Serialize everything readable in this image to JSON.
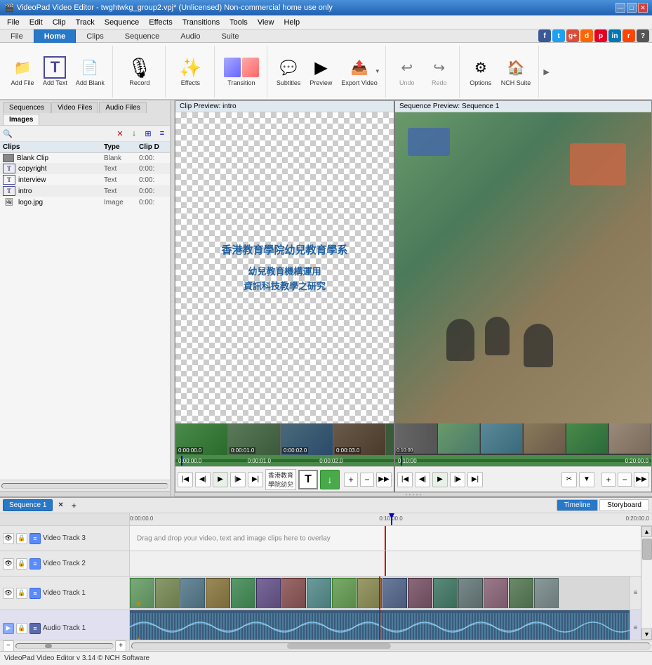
{
  "titlebar": {
    "title": "VideoPad Video Editor - twghtwkg_group2.vpj* (Unlicensed) Non-commercial home use only",
    "icon": "🎬"
  },
  "titlebar_controls": [
    "—",
    "□",
    "✕"
  ],
  "menubar": {
    "items": [
      "File",
      "Edit",
      "Clip",
      "Track",
      "Sequence",
      "Effects",
      "Transitions",
      "Tools",
      "View",
      "Help"
    ]
  },
  "ribbon": {
    "tabs": [
      {
        "label": "File",
        "active": false
      },
      {
        "label": "Home",
        "active": true,
        "style": "home"
      },
      {
        "label": "Clips",
        "active": false
      },
      {
        "label": "Sequence",
        "active": false
      },
      {
        "label": "Audio",
        "active": false
      },
      {
        "label": "Suite",
        "active": false
      }
    ],
    "buttons": [
      {
        "label": "Add File",
        "icon": "📁",
        "group": "add"
      },
      {
        "label": "Add Text",
        "icon": "T",
        "group": "add"
      },
      {
        "label": "Add Blank",
        "icon": "📄",
        "group": "add"
      },
      {
        "label": "Record",
        "icon": "🎙",
        "group": "record"
      },
      {
        "label": "Effects",
        "icon": "✨",
        "group": "effects"
      },
      {
        "label": "Transition",
        "icon": "⇄",
        "group": "transition"
      },
      {
        "label": "Subtitles",
        "icon": "💬",
        "group": "subtitles"
      },
      {
        "label": "Preview",
        "icon": "▶",
        "group": "preview"
      },
      {
        "label": "Export Video",
        "icon": "📤",
        "group": "export"
      },
      {
        "label": "Undo",
        "icon": "↩",
        "group": "edit",
        "disabled": true
      },
      {
        "label": "Redo",
        "icon": "↪",
        "group": "edit",
        "disabled": true
      },
      {
        "label": "Options",
        "icon": "⚙",
        "group": "tools"
      },
      {
        "label": "NCH Suite",
        "icon": "🏠",
        "group": "tools"
      }
    ],
    "more_btn": "▶"
  },
  "clips_panel": {
    "tabs": [
      "Sequences",
      "Video Files",
      "Audio Files",
      "Images"
    ],
    "active_tab": "Images",
    "columns": [
      "Clips",
      "Type",
      "Clip D"
    ],
    "items": [
      {
        "name": "Blank Clip",
        "type": "Blank",
        "duration": "0:00:",
        "icon": "blank"
      },
      {
        "name": "copyright",
        "type": "Text",
        "duration": "0:00:",
        "icon": "text"
      },
      {
        "name": "interview",
        "type": "Text",
        "duration": "0:00:",
        "icon": "text"
      },
      {
        "name": "intro",
        "type": "Text",
        "duration": "0:00:",
        "icon": "text"
      },
      {
        "name": "logo.jpg",
        "type": "Image",
        "duration": "0:00:",
        "icon": "image"
      }
    ]
  },
  "clip_preview": {
    "title": "Clip Preview: intro",
    "text_lines": [
      "香港教育學院幼兒教育學系",
      "幼兒教育機構運用",
      "資訊科技教學之研究"
    ],
    "timecode": "香港教育\n學院幼兒",
    "thumbnails": [
      {
        "time": "0:00:00.0"
      },
      {
        "time": "0:00:01.0"
      },
      {
        "time": "0:00:02.0"
      },
      {
        "time": "0:00:03.0"
      }
    ]
  },
  "seq_preview": {
    "title": "Sequence Preview: Sequence 1",
    "thumbnails": 6
  },
  "sequence_panel": {
    "seq_tab": "Sequence 1",
    "view_tabs": [
      "Timeline",
      "Storyboard"
    ],
    "active_view": "Timeline",
    "ruler_marks": [
      {
        "time": "0:00:00.0",
        "pos": 0
      },
      {
        "time": "0:10:00.0",
        "pos": 50
      },
      {
        "time": "0:20:00.0",
        "pos": 100
      }
    ],
    "tracks": [
      {
        "name": "Video Track 3",
        "type": "video",
        "empty": true,
        "empty_msg": "Drag and drop your video, text and image clips here to overlay"
      },
      {
        "name": "Video Track 2",
        "type": "video",
        "empty": true,
        "empty_msg": ""
      },
      {
        "name": "Video Track 1",
        "type": "video",
        "empty": false,
        "has_clips": true
      },
      {
        "name": "Audio Track 1",
        "type": "audio",
        "empty": false,
        "has_audio": true
      }
    ],
    "playhead_pos": "0:10:00.0"
  },
  "statusbar": {
    "text": "VideoPad Video Editor v 3.14  © NCH Software"
  },
  "social_icons": [
    {
      "color": "#3b5998",
      "label": "f"
    },
    {
      "color": "#1da1f2",
      "label": "t"
    },
    {
      "color": "#dd4b39",
      "label": "g"
    },
    {
      "color": "#ff6600",
      "label": "d"
    },
    {
      "color": "#e60023",
      "label": "p"
    },
    {
      "color": "#0077b5",
      "label": "in"
    },
    {
      "color": "#ff4500",
      "label": "r"
    },
    {
      "color": "#555555",
      "label": "?"
    }
  ]
}
